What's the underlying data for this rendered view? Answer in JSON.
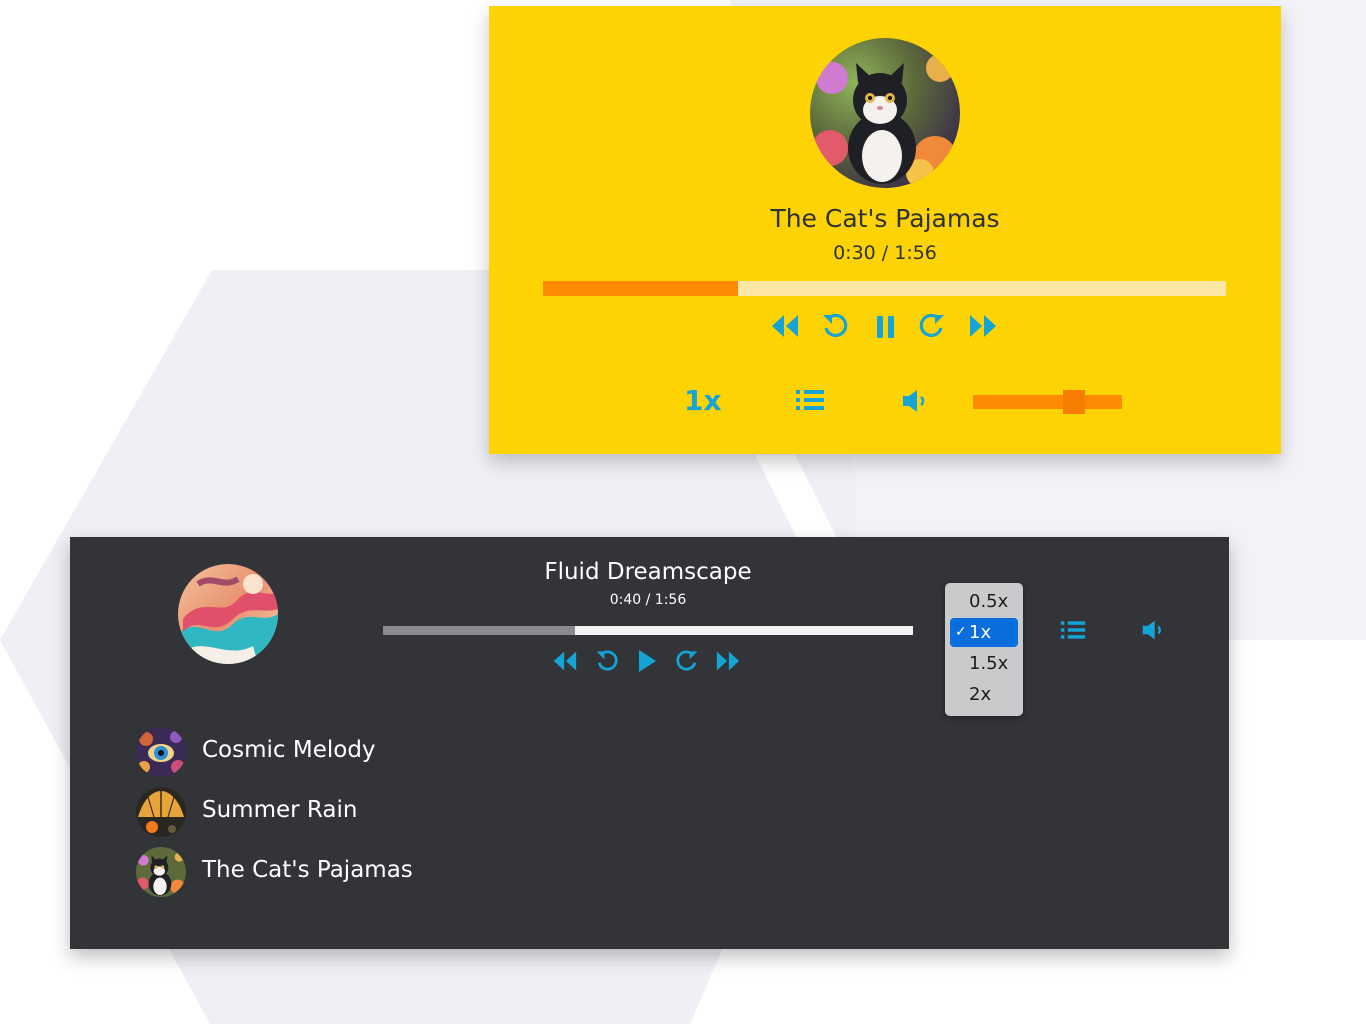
{
  "colors": {
    "yellow_bg": "#fdd303",
    "dark_bg": "#323438",
    "accent_icon": "#15a4d6",
    "progress_orange": "#fd8a00",
    "selected_option": "#0a6edc"
  },
  "yellow_player": {
    "cover_icon": "cat-album-art",
    "title": "The Cat's Pajamas",
    "time": "0:30 / 1:56",
    "progress_fraction": 0.285,
    "controls": [
      "rewind-icon",
      "replay-icon",
      "pause-icon",
      "forward-skip-icon",
      "fast-forward-icon"
    ],
    "rate_label": "1x",
    "playlist_icon": "list-icon",
    "volume_icon": "speaker-icon",
    "volume_fraction": 0.68
  },
  "dark_player": {
    "cover_icon": "fluid-album-art",
    "title": "Fluid Dreamscape",
    "time": "0:40 / 1:56",
    "progress_fraction": 0.363,
    "controls": [
      "rewind-icon",
      "replay-icon",
      "play-icon",
      "forward-skip-icon",
      "fast-forward-icon"
    ],
    "rate_options": [
      "0.5x",
      "1x",
      "1.5x",
      "2x"
    ],
    "rate_selected": "1x",
    "check_mark": "✓",
    "playlist_icon": "list-icon",
    "volume_icon": "speaker-icon",
    "playlist": [
      {
        "title": "Cosmic Melody",
        "thumb_icon": "cosmic-eye-thumb"
      },
      {
        "title": "Summer Rain",
        "thumb_icon": "umbrella-thumb"
      },
      {
        "title": "The Cat's Pajamas",
        "thumb_icon": "cat-thumb"
      }
    ]
  }
}
